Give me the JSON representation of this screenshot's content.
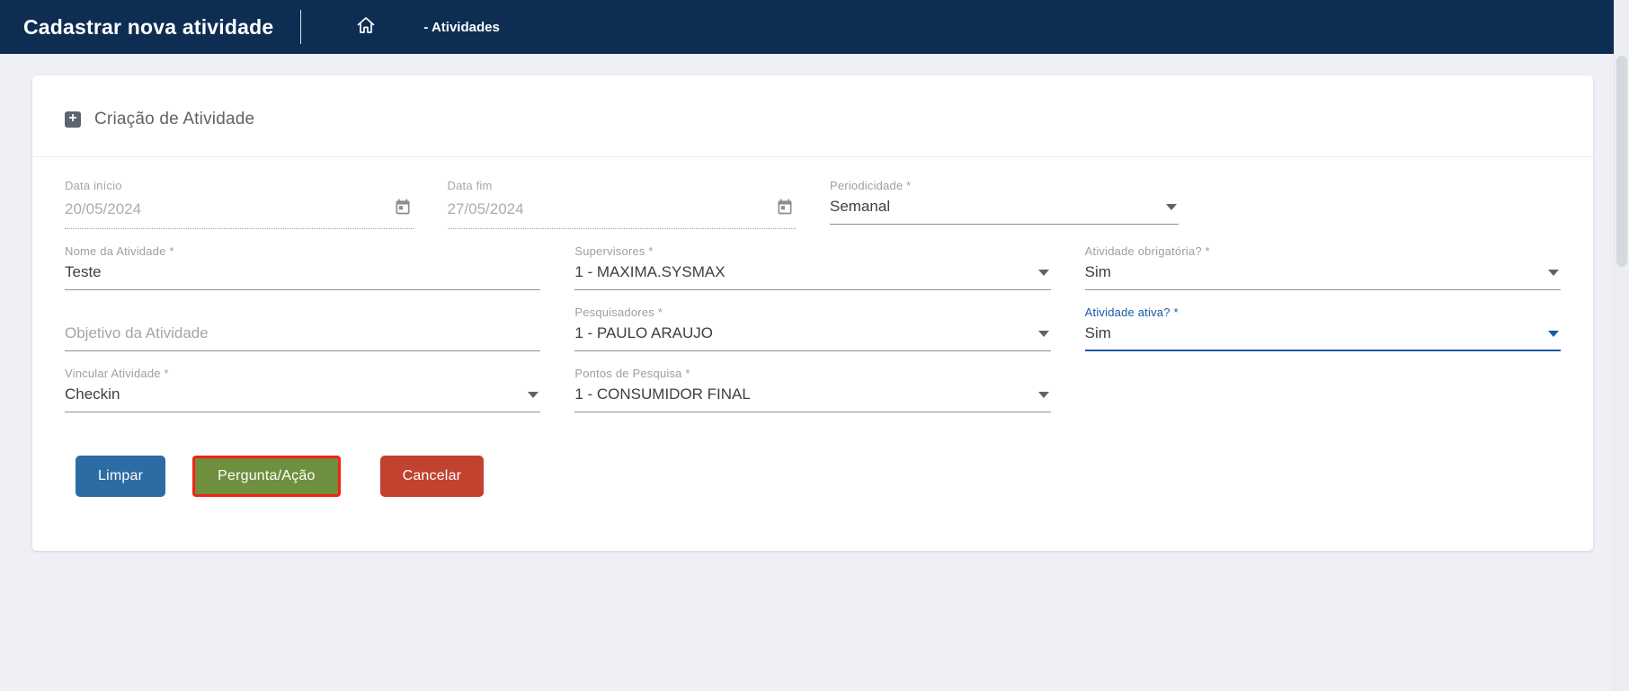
{
  "header": {
    "title": "Cadastrar nova atividade",
    "breadcrumb": "- Atividades"
  },
  "card": {
    "title": "Criação de Atividade",
    "title_icon": "+"
  },
  "fields": {
    "data_inicio": {
      "label": "Data início",
      "value": "20/05/2024",
      "state": "disabled"
    },
    "data_fim": {
      "label": "Data fim",
      "value": "27/05/2024",
      "state": "disabled"
    },
    "periodicidade": {
      "label": "Periodicidade *",
      "value": "Semanal"
    },
    "nome": {
      "label": "Nome da Atividade *",
      "value": "Teste"
    },
    "supervisores": {
      "label": "Supervisores *",
      "value": "1 - MAXIMA.SYSMAX"
    },
    "obrigatoria": {
      "label": "Atividade obrigatória? *",
      "value": "Sim"
    },
    "objetivo": {
      "label": "",
      "value": "",
      "placeholder": "Objetivo da Atividade"
    },
    "pesquisadores": {
      "label": "Pesquisadores *",
      "value": "1 - PAULO ARAUJO"
    },
    "ativa": {
      "label": "Atividade ativa? *",
      "value": "Sim",
      "state": "focused"
    },
    "vincular": {
      "label": "Vincular Atividade *",
      "value": "Checkin"
    },
    "pontos": {
      "label": "Pontos de Pesquisa *",
      "value": "1 - CONSUMIDOR FINAL"
    }
  },
  "buttons": {
    "limpar": {
      "label": "Limpar",
      "color": "#2c6ca5"
    },
    "pergunta": {
      "label": "Pergunta/Ação",
      "color": "#6e8f3d",
      "highlight_border": "#f42313"
    },
    "cancelar": {
      "label": "Cancelar",
      "color": "#c2422f"
    }
  },
  "colors": {
    "topbar_bg": "#0d2e52",
    "page_bg": "#eef0f5",
    "focus_accent": "#1b57a8",
    "label_gray": "#9aa0a6",
    "value_dark": "#3c4043"
  }
}
